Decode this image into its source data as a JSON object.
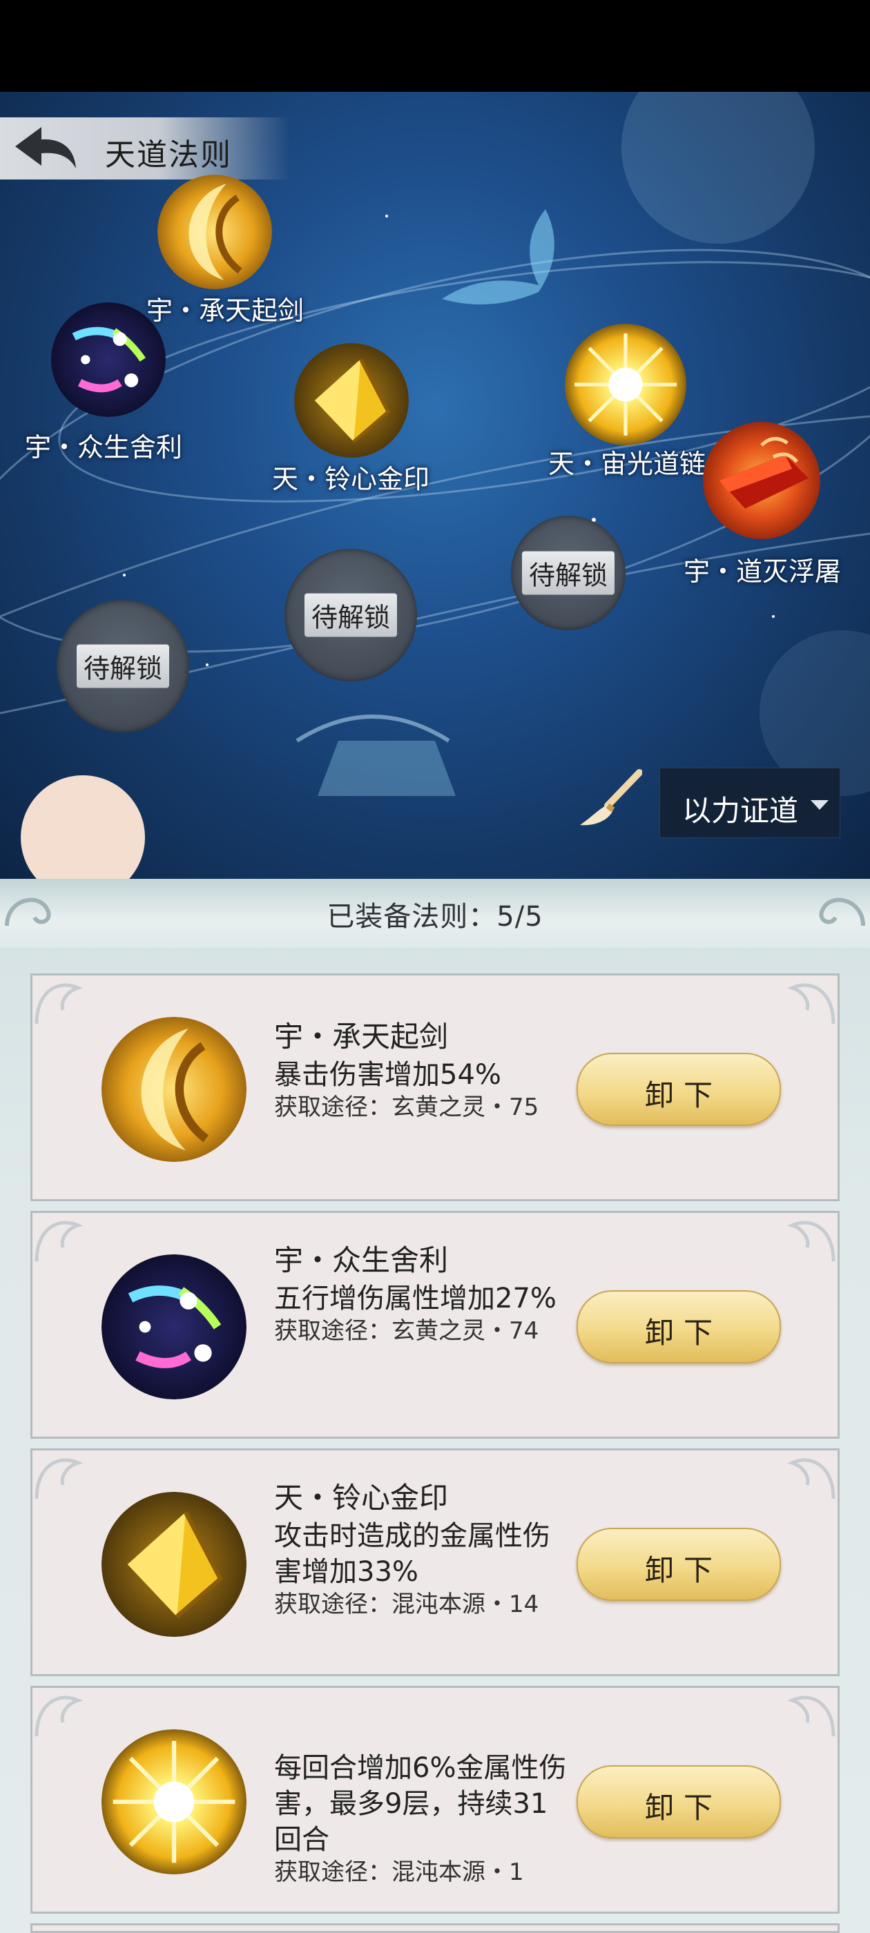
{
  "header": {
    "title": "天道法则"
  },
  "map": {
    "nodes": [
      {
        "label": "宇・承天起剑",
        "icon": "golden-crescent-icon"
      },
      {
        "label": "宇・众生舍利",
        "icon": "rainbow-comet-orb-icon"
      },
      {
        "label": "天・铃心金印",
        "icon": "gold-crystal-icon"
      },
      {
        "label": "天・宙光道链",
        "icon": "radiant-sun-icon"
      },
      {
        "label": "宇・道灭浮屠",
        "icon": "fire-gem-icon"
      }
    ],
    "locked": [
      {
        "label": "待解锁"
      },
      {
        "label": "待解锁"
      },
      {
        "label": "待解锁"
      }
    ],
    "brush_icon": "brush-icon",
    "filter": {
      "label": "以力证道"
    }
  },
  "panel": {
    "equipped_text": "已装备法则：5/5",
    "cards": [
      {
        "name": "宇・承天起剑",
        "desc": "暴击伤害增加54%",
        "source": "获取途径：玄黄之灵・75",
        "button": "卸下"
      },
      {
        "name": "宇・众生舍利",
        "desc": "五行增伤属性增加27%",
        "source": "获取途径：玄黄之灵・74",
        "button": "卸下"
      },
      {
        "name": "天・铃心金印",
        "desc": "攻击时造成的金属性伤害增加33%",
        "source": "获取途径：混沌本源・14",
        "button": "卸下"
      },
      {
        "name": "",
        "desc": "每回合增加6%金属性伤害，最多9层，持续31回合",
        "source": "获取途径：混沌本源・1",
        "button": "卸下"
      }
    ]
  },
  "colors": {
    "button_gold": "#f3d98a",
    "card_bg": "#efe8e8",
    "map_blue": "#1e4f8c"
  }
}
